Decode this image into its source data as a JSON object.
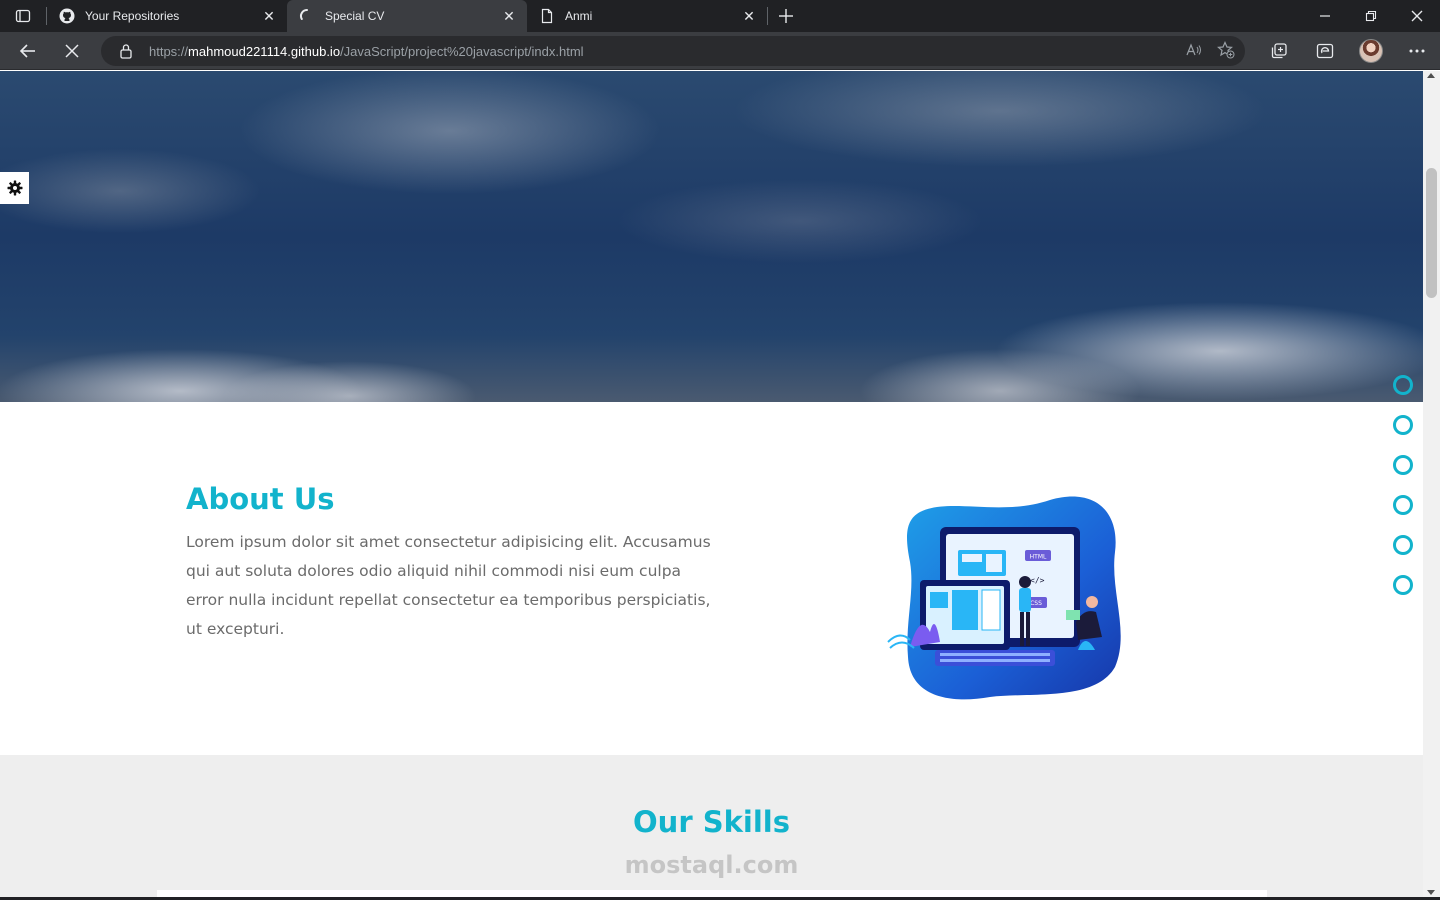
{
  "browser": {
    "tabs": [
      {
        "title": "Your Repositories",
        "icon": "github-icon",
        "active": false
      },
      {
        "title": "Special CV",
        "icon": "loading-spinner-icon",
        "active": true
      },
      {
        "title": "Anmi",
        "icon": "document-icon",
        "active": false
      }
    ],
    "address": {
      "scheme": "https://",
      "host": "mahmoud221114.github.io",
      "path": "/JavaScript/project%20javascript/indx.html"
    }
  },
  "page": {
    "about": {
      "heading": "About Us",
      "body": "Lorem ipsum dolor sit amet consectetur adipisicing elit. Accusamus qui aut soluta dolores odio aliquid nihil commodi nisi eum culpa error nulla incidunt repellat consectetur ea temporibus perspiciatis, ut excepturi."
    },
    "skills": {
      "heading": "Our Skills"
    },
    "watermark": "mostaql.com",
    "illustration_labels": {
      "html": "HTML",
      "css": "CSS",
      "code": "</>"
    },
    "nav_bullets_count": 6,
    "colors": {
      "accent": "#12b3cc",
      "text": "#6b6b6b",
      "skills_bg": "#eeeeee"
    }
  }
}
